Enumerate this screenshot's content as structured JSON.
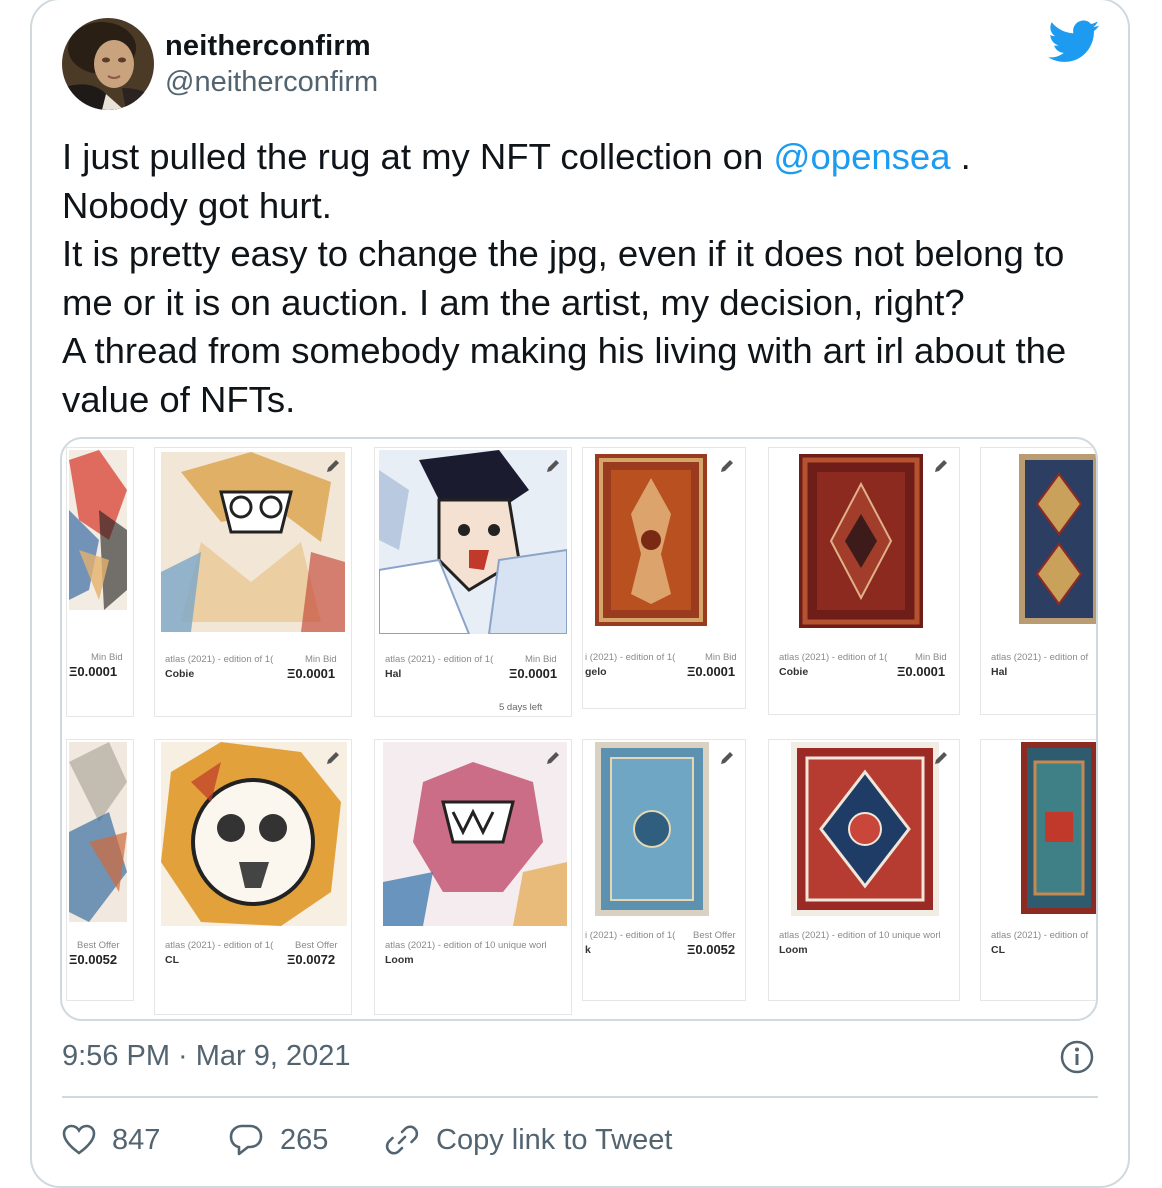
{
  "user": {
    "display_name": "neitherconfirm",
    "handle": "@neitherconfirm"
  },
  "tweet": {
    "text_before": "I just pulled the rug at my NFT collection on ",
    "mention": "@opensea",
    "text_after": " .\nNobody got hurt.\nIt is pretty easy to change the jpg, even if it does not belong to me or it is on auction. I am the artist, my decision, right?\nA thread from somebody making his living with art irl about the value of NFTs.",
    "timestamp": "9:56 PM · Mar 9, 2021"
  },
  "media": {
    "row1": [
      {
        "title": "",
        "name": "",
        "price_label": "Min Bid",
        "price": "Ξ0.0001"
      },
      {
        "title": "atlas (2021) - edition of 1(",
        "name": "Cobie",
        "price_label": "Min Bid",
        "price": "Ξ0.0001"
      },
      {
        "title": "atlas (2021) - edition of 1(",
        "name": "Hal",
        "price_label": "Min Bid",
        "price": "Ξ0.0001",
        "extra": "5 days left"
      },
      {
        "title": "i (2021) - edition of 1(",
        "name": "gelo",
        "price_label": "Min Bid",
        "price": "Ξ0.0001"
      },
      {
        "title": "atlas (2021) - edition of 1(",
        "name": "Cobie",
        "price_label": "Min Bid",
        "price": "Ξ0.0001"
      },
      {
        "title": "atlas (2021) - edition of",
        "name": "Hal",
        "price_label": "",
        "price": ""
      }
    ],
    "row2": [
      {
        "title": "",
        "name": "",
        "price_label": "Best Offer",
        "price": "Ξ0.0052"
      },
      {
        "title": "atlas (2021) - edition of 1(",
        "name": "CL",
        "price_label": "Best Offer",
        "price": "Ξ0.0072"
      },
      {
        "title": "atlas (2021) - edition of 10 unique worl",
        "name": "Loom",
        "price_label": "",
        "price": ""
      },
      {
        "title": "i (2021) - edition of 1(",
        "name": "k",
        "price_label": "Best Offer",
        "price": "Ξ0.0052"
      },
      {
        "title": "atlas (2021) - edition of 10 unique worl",
        "name": "Loom",
        "price_label": "",
        "price": ""
      },
      {
        "title": "atlas (2021) - edition of",
        "name": "CL",
        "price_label": "",
        "price": ""
      }
    ]
  },
  "actions": {
    "likes": "847",
    "replies": "265",
    "copy_link": "Copy link to Tweet"
  },
  "colors": {
    "accent": "#1d9bf0",
    "text": "#0f1419",
    "muted": "#536471",
    "border": "#cfd9de"
  }
}
